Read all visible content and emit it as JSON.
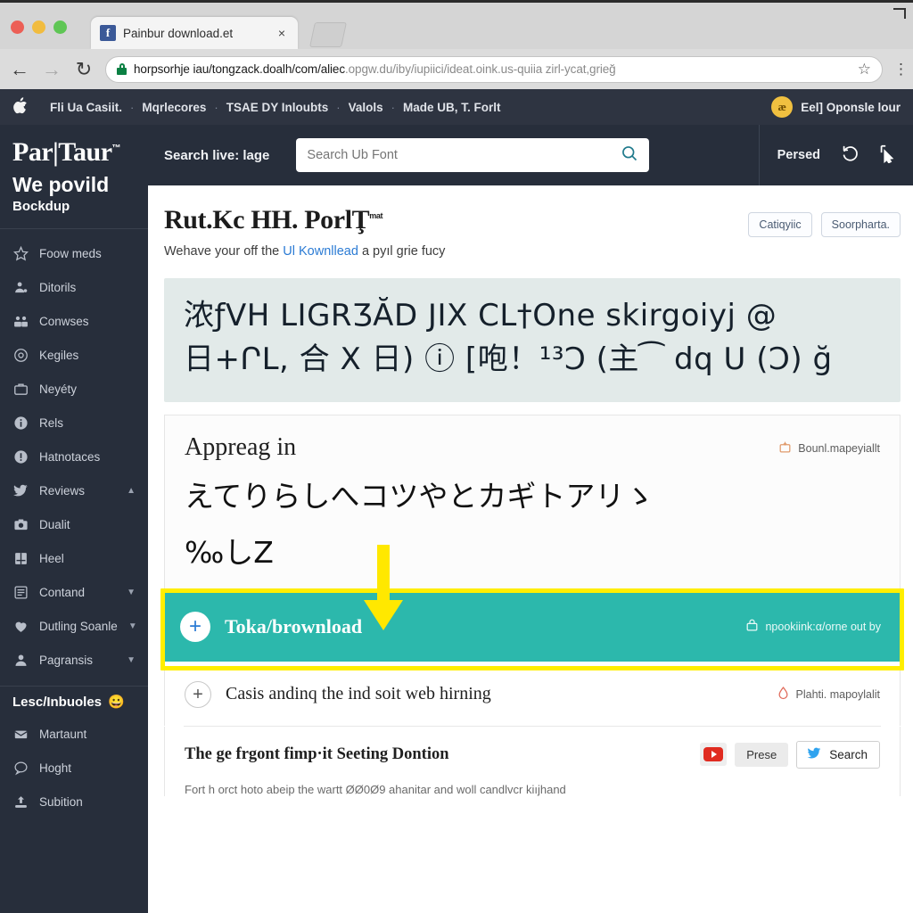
{
  "browser": {
    "tab": {
      "title": "Painbur download.et",
      "favicon": "f",
      "close_label": "×"
    },
    "nav": {
      "back": "←",
      "forward": "→",
      "reload": "↻"
    },
    "omnibox": {
      "url_secure": "horpsorhje iau/tongzack.doalh/com/aliec",
      "url_dim": ".opgw.du/iby/iupiici/ideat.oink.us-quiia zirl-ycat,grieğ",
      "star": "☆",
      "menu": "⋮"
    }
  },
  "topbar": {
    "logo": "",
    "items": [
      {
        "label": "Fli Ua Casiit."
      },
      {
        "label": "Mqrlecores"
      },
      {
        "label": "TSAE DY Inloubts"
      },
      {
        "label": "Valols"
      },
      {
        "label": "Made UB, T. Forlt"
      }
    ],
    "separator": "·",
    "avatar_initial": "æ",
    "user_label": "Eel]  Oponsle lour"
  },
  "sitebar": {
    "left_label": "Search live: lage",
    "search_placeholder": "Search Ub Font",
    "search_value": "",
    "search_icon": "search-icon",
    "right_label": "Persed",
    "icon_history": "history-icon",
    "icon_cursor": "cursor-icon"
  },
  "sidebar": {
    "brand": "Par|Taur",
    "brand_tm": "™",
    "tagline1": "We povild",
    "tagline2": "Bockdup",
    "items": [
      {
        "label": "Foow meds",
        "icon": "star-icon",
        "chevron": ""
      },
      {
        "label": "Ditorils",
        "icon": "person-gear-icon",
        "chevron": ""
      },
      {
        "label": "Conwses",
        "icon": "people-icon",
        "chevron": ""
      },
      {
        "label": "Kegiles",
        "icon": "circle-dot-icon",
        "chevron": ""
      },
      {
        "label": "Neyéty",
        "icon": "briefcase-icon",
        "chevron": ""
      },
      {
        "label": "Rels",
        "icon": "info-icon",
        "chevron": ""
      },
      {
        "label": "Hatnotaces",
        "icon": "alert-icon",
        "chevron": ""
      },
      {
        "label": "Reviews",
        "icon": "bird-icon",
        "chevron": "▲"
      },
      {
        "label": "Dualit",
        "icon": "camera-icon",
        "chevron": ""
      },
      {
        "label": "Heel",
        "icon": "factory-icon",
        "chevron": ""
      },
      {
        "label": "Contand",
        "icon": "list-icon",
        "chevron": "▼"
      },
      {
        "label": "Dutling Soanle",
        "icon": "heart-icon",
        "chevron": "▼"
      },
      {
        "label": "Pagransis",
        "icon": "user-icon",
        "chevron": "▼"
      }
    ],
    "section_title": "Lesc/Inbuoles",
    "section_emoji": "😀",
    "section_items": [
      {
        "label": "Martaunt",
        "icon": "inbox-icon"
      },
      {
        "label": "Hoght",
        "icon": "chat-icon"
      },
      {
        "label": "Subition",
        "icon": "upload-icon"
      }
    ]
  },
  "page": {
    "title": "Rut.Kc HH. PorlŢ",
    "title_sup": "mat",
    "subtitle_before": "Wehave your off the ",
    "subtitle_link": "Ul Kownllead",
    "subtitle_after": " a pyıl grie fucy",
    "buttons": [
      {
        "label": "Catiqyiic"
      },
      {
        "label": "Soorpharta."
      }
    ],
    "glyph_preview": {
      "line1": "浓ƒVH LIGRƷĂD JIX CL†One skirgoiyj @",
      "line2": "日+ՐL, 合 X 日) ⓘ [咆！¹³Ɔ (主⁀ dq U (Ɔ) ğ"
    },
    "sample": {
      "title": "Appreag in",
      "glyph_line1": "えてりらしへコツやとカギトアリゝ",
      "glyph_line2": "‰しZ",
      "meta_label": "Bounl.mapeyiallt",
      "meta_icon": "download-box-icon"
    },
    "download": {
      "label": "Toka/brownload",
      "plus": "+",
      "meta_label": "npookiink:α/orne out by",
      "meta_icon": "lock-box-icon",
      "bar_color": "#2cb8ac",
      "highlight_color": "#ffee00"
    },
    "accordion": [
      {
        "label": "Casis andinq the ind soit web hirning",
        "plus": "+",
        "meta_label": "Plahti. mapoylalit",
        "meta_icon": "drop-icon"
      }
    ],
    "share": {
      "title": "The ge frgont fimp·it Seeting Dontion",
      "desc": "Fort h orct hoto abeip the wartt ØØ0Ø9 ahanitar and woll candlvcr kiıjhand",
      "youtube_icon": "youtube-icon",
      "press_label": "Prese",
      "twitter_icon": "twitter-icon",
      "search_label": "Search"
    }
  },
  "colors": {
    "chrome_bg": "#d8d8d8",
    "topbar_bg": "#2e3441",
    "sidebar_bg": "#272e3b",
    "teal": "#2cb8ac",
    "yellow": "#ffee00",
    "link_blue": "#2b7bd4",
    "glyph_panel_bg": "#e2eae9"
  }
}
